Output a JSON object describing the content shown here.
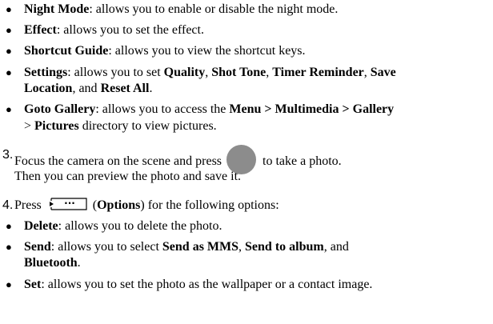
{
  "bullets_top": [
    {
      "bold": "Night Mode",
      "rest": ": allows you to enable or disable the night mode."
    },
    {
      "bold": "Effect",
      "rest": ": allows you to set the effect."
    },
    {
      "bold": "Shortcut Guide",
      "rest": ": allows you to view the shortcut keys."
    }
  ],
  "settings": {
    "bold": "Settings",
    "t1": ": allows you to set ",
    "b1": "Quality",
    "t2": ", ",
    "b2": "Shot Tone",
    "t3": ", ",
    "b3": "Timer Reminder",
    "t4": ", ",
    "b4": "Save",
    "b5": "Location",
    "t5": ", and ",
    "b6": "Reset All",
    "t6": "."
  },
  "gallery": {
    "bold": "Goto Gallery",
    "t1": ": allows you to access the ",
    "b1": "Menu > Multimedia > Gallery",
    "t2": "> ",
    "b2": "Pictures",
    "t3": " directory to view pictures."
  },
  "step3": {
    "num": "3.",
    "t1": "Focus the camera on the scene and press",
    "t2": "to take a photo.",
    "t3": "Then you can preview the photo and save it.",
    "icon": "camera-shutter-icon"
  },
  "step4": {
    "num": "4.",
    "t1": "Press",
    "icon": "options-softkey-icon",
    "key_dots": "···",
    "paren_open": "(",
    "b1": "Options",
    "t2": ") for the following options:"
  },
  "bullets_bottom": {
    "delete": {
      "bold": "Delete",
      "rest": ": allows you to delete the photo."
    },
    "send": {
      "bold": "Send",
      "t1": ": allows you to select ",
      "b1": "Send as MMS",
      "t2": ", ",
      "b2": "Send to album",
      "t3": ", and",
      "b3": "Bluetooth",
      "t4": "."
    },
    "set": {
      "bold": "Set",
      "rest": ": allows you to set the photo as the wallpaper or a contact image."
    }
  }
}
